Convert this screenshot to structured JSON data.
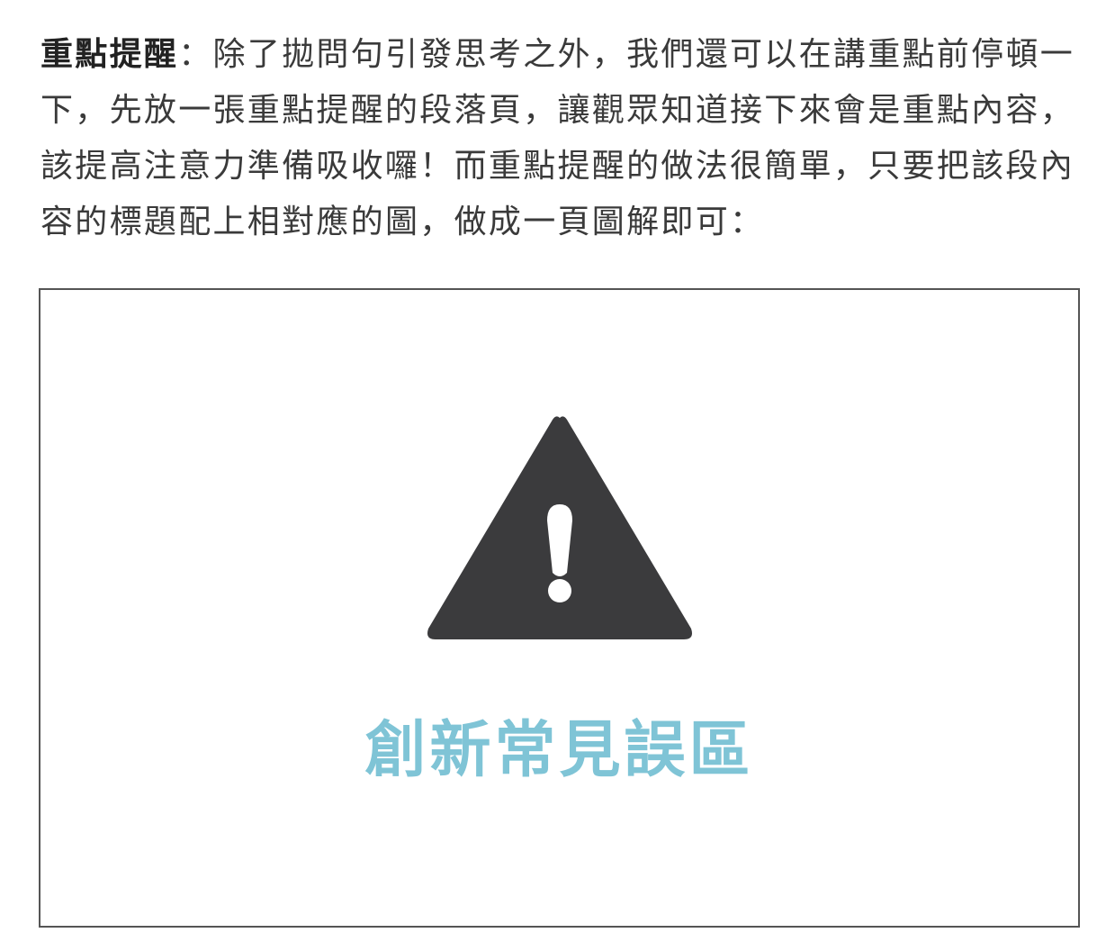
{
  "paragraph": {
    "lead": "重點提醒",
    "body": "：除了拋問句引發思考之外，我們還可以在講重點前停頓一下，先放一張重點提醒的段落頁，讓觀眾知道接下來會是重點內容，該提高注意力準備吸收囉！而重點提醒的做法很簡單，只要把該段內容的標題配上相對應的圖，做成一頁圖解即可："
  },
  "slide": {
    "icon": "warning-triangle-icon",
    "title": "創新常見誤區",
    "title_color": "#7fc4d6",
    "icon_color": "#3b3b3d"
  }
}
